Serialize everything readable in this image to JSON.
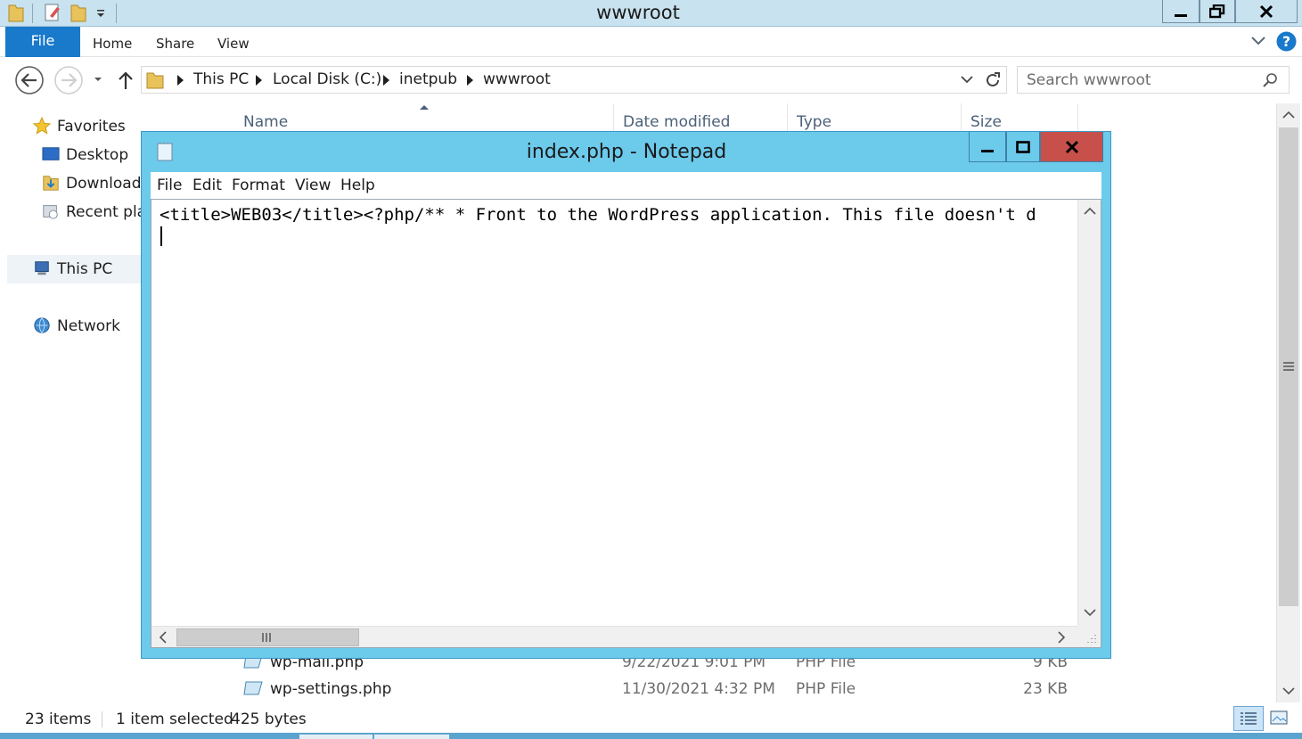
{
  "explorer": {
    "title": "wwwroot",
    "ribbon_tabs": [
      "File",
      "Home",
      "Share",
      "View"
    ],
    "breadcrumbs": [
      "This PC",
      "Local Disk (C:)",
      "inetpub",
      "wwwroot"
    ],
    "search_placeholder": "Search wwwroot",
    "nav": {
      "favorites": "Favorites",
      "desktop": "Desktop",
      "downloads": "Downloads",
      "recent": "Recent places",
      "this_pc": "This PC",
      "network": "Network"
    },
    "columns": [
      "Name",
      "Date modified",
      "Type",
      "Size"
    ],
    "files": [
      {
        "name": "wp-mail.php",
        "date": "9/22/2021 9:01 PM",
        "type": "PHP File",
        "size": "9 KB"
      },
      {
        "name": "wp-settings.php",
        "date": "11/30/2021 4:32 PM",
        "type": "PHP File",
        "size": "23 KB"
      }
    ],
    "status": {
      "items": "23 items",
      "selected": "1 item selected",
      "size": "425 bytes"
    },
    "icons": {
      "back": "back-arrow-icon",
      "forward": "forward-arrow-icon",
      "up": "up-arrow-icon",
      "refresh": "refresh-icon",
      "search": "search-icon",
      "help": "help-icon"
    }
  },
  "notepad": {
    "title": "index.php - Notepad",
    "menu": [
      "File",
      "Edit",
      "Format",
      "View",
      "Help"
    ],
    "content": "<title>WEB03</title><?php/** * Front to the WordPress application. This file doesn't d"
  },
  "colors": {
    "explorer_titlebar": "#c9e2ef",
    "file_tab": "#1979ca",
    "notepad_frame": "#6ccaeb",
    "close_button": "#c7504b",
    "taskbar": "#5ba4cf"
  }
}
